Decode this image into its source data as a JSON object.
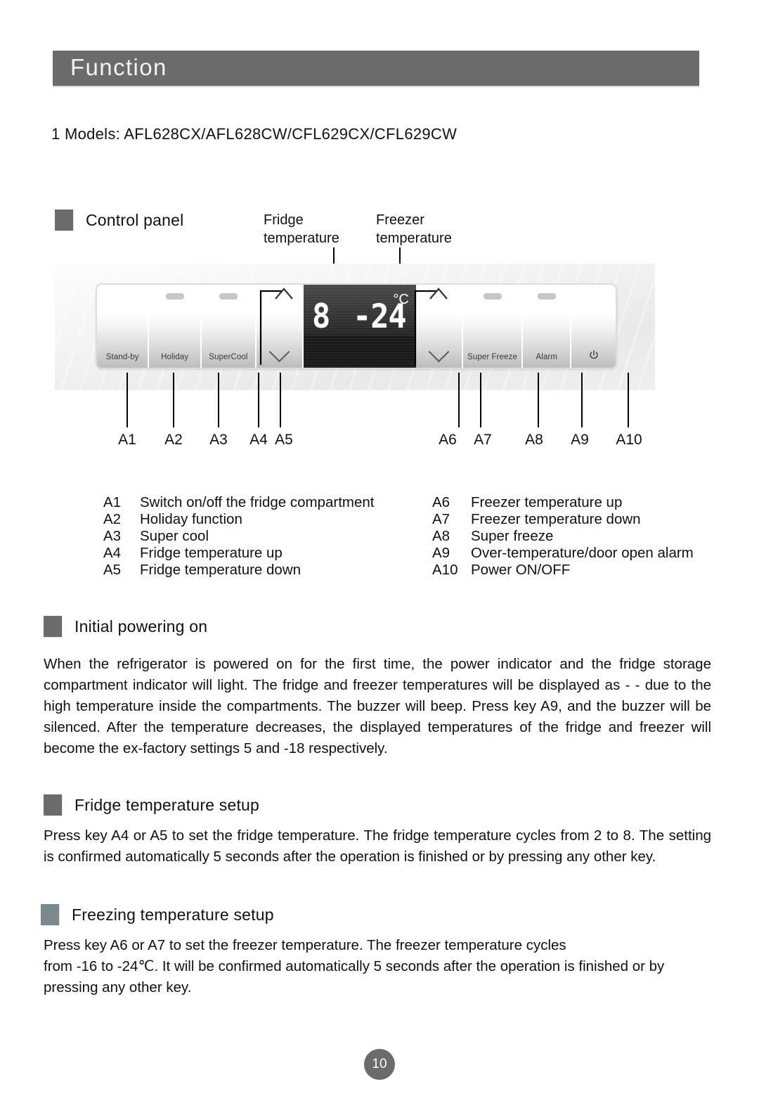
{
  "header": {
    "title": "Function"
  },
  "models": {
    "line": "1 Models: AFL628CX/AFL628CW/CFL629CX/CFL629CW"
  },
  "sections": {
    "control_panel": {
      "title": "Control panel"
    },
    "initial_powering": {
      "title": "Initial powering on"
    },
    "fridge_setup": {
      "title": "Fridge temperature setup"
    },
    "freezing_setup": {
      "title": "Freezing temperature setup"
    }
  },
  "callouts": {
    "fridge_line1": "Fridge",
    "fridge_line2": "temperature",
    "freezer_line1": "Freezer",
    "freezer_line2": "temperature"
  },
  "panel": {
    "keys": [
      {
        "id": "A1",
        "label": "Stand-by",
        "type": "text",
        "led": false
      },
      {
        "id": "A2",
        "label": "Holiday",
        "type": "text",
        "led": true
      },
      {
        "id": "A3",
        "label": "SuperCool",
        "type": "text",
        "led": true
      },
      {
        "id": "A4",
        "label": "up-chevron",
        "type": "arrow-up",
        "led": false
      },
      {
        "id": "A5",
        "label": "down-chevron",
        "type": "arrow-down",
        "led": false
      },
      {
        "id": "A6",
        "label": "up-chevron",
        "type": "arrow-up",
        "led": false
      },
      {
        "id": "A7",
        "label": "down-chevron",
        "type": "arrow-down",
        "led": false
      },
      {
        "id": "A8",
        "label": "Super Freeze",
        "type": "text",
        "led": true
      },
      {
        "id": "A9",
        "label": "Alarm",
        "type": "text",
        "led": true
      },
      {
        "id": "A10",
        "label": "power-symbol",
        "type": "power",
        "led": false
      }
    ],
    "display": {
      "fridge_value": "8",
      "freezer_value": "-24",
      "unit": "°C"
    },
    "tick_labels": [
      "A1",
      "A2",
      "A3",
      "A4",
      "A5",
      "A6",
      "A7",
      "A8",
      "A9",
      "A10"
    ]
  },
  "legend": {
    "left": [
      {
        "code": "A1",
        "text": "Switch on/off the fridge compartment"
      },
      {
        "code": "A2",
        "text": "Holiday function"
      },
      {
        "code": "A3",
        "text": "Super cool"
      },
      {
        "code": "A4",
        "text": "Fridge temperature up"
      },
      {
        "code": "A5",
        "text": "Fridge temperature down"
      }
    ],
    "right": [
      {
        "code": "A6",
        "text": "Freezer temperature up"
      },
      {
        "code": "A7",
        "text": "Freezer temperature down"
      },
      {
        "code": "A8",
        "text": "Super freeze"
      },
      {
        "code": "A9",
        "text": "Over-temperature/door open alarm"
      },
      {
        "code": "A10",
        "text": "Power ON/OFF"
      }
    ]
  },
  "body": {
    "initial_powering": "When the refrigerator is powered on for the first time, the power indicator and the fridge storage compartment indicator will light. The fridge and freezer temperatures will be displayed as  -  -  due  to the high temperature inside the compartments. The buzzer will beep. Press key A9, and the buzzer will be silenced. After the temperature decreases, the displayed temperatures of the fridge and freezer will become the ex-factory settings  5  and  -18  respectively.",
    "fridge_setup": "Press key A4 or A5 to set the fridge temperature. The fridge temperature cycles from 2 to 8. The setting is confirmed automatically 5 seconds after the operation is finished or by pressing any other key.",
    "freezing_setup_line1": "Press key A6 or A7 to set the freezer temperature.  The freezer temperature cycles",
    "freezing_setup_line2": "from -16 to -24℃. It will be confirmed automatically 5 seconds after the operation is finished or by",
    "freezing_setup_line3": "pressing any other key."
  },
  "footer": {
    "page_number": "10"
  },
  "colors": {
    "header_bg": "#6b6b6b",
    "bullet_gray": "#6b6b6b",
    "bullet_teal": "#79898c",
    "lcd_bg": "#1b1b1b"
  }
}
